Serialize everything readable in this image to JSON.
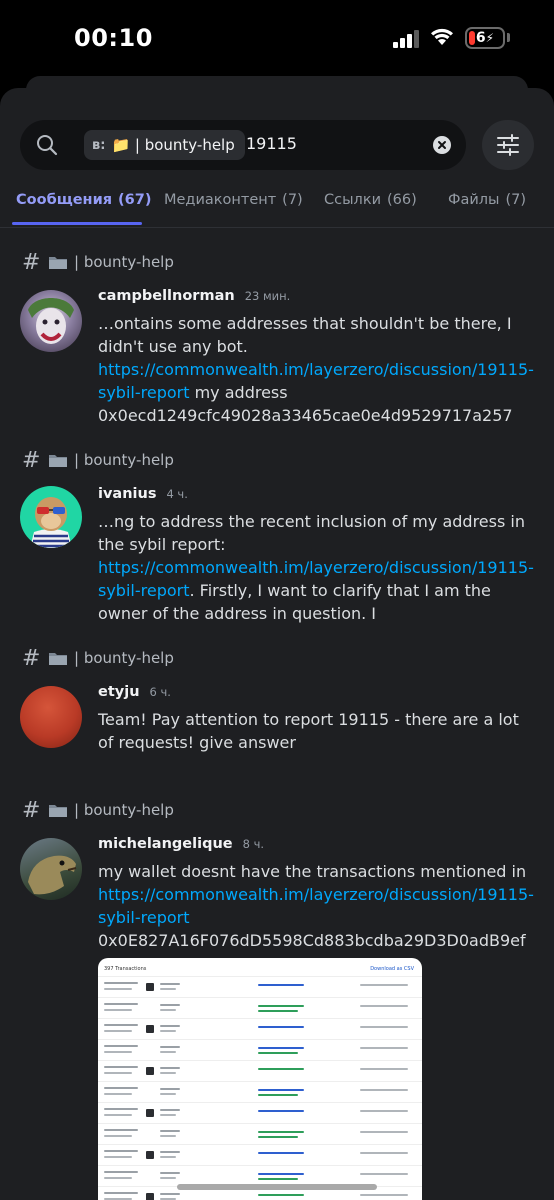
{
  "status_bar": {
    "time": "00:10",
    "battery": "6"
  },
  "search": {
    "scope_prefix": "в:",
    "scope_channel": "📁 | bounty-help",
    "query": "19115"
  },
  "tabs": [
    {
      "label": "Сообщения",
      "count": "(67)",
      "active": true
    },
    {
      "label": "Медиаконтент",
      "count": "(7)",
      "active": false
    },
    {
      "label": "Ссылки",
      "count": "(66)",
      "active": false
    },
    {
      "label": "Файлы",
      "count": "(7)",
      "active": false
    }
  ],
  "results": [
    {
      "channel": "| bounty-help",
      "author": "campbellnorman",
      "time": "23 мин.",
      "text_before": "…ontains some addresses that shouldn't be there, I didn't use any bot. ",
      "link": "https://commonwealth.im/layerzero/discussion/19115-sybil-report",
      "text_after": " my address 0x0ecd1249cfc49028a33465cae0e4d9529717a257"
    },
    {
      "channel": "| bounty-help",
      "author": "ivanius",
      "time": "4 ч.",
      "text_before": "…ng to address the recent inclusion of my address in the sybil report: ",
      "link": "https://commonwealth.im/layerzero/discussion/19115-sybil-report",
      "text_after": ". Firstly, I want to clarify that I am the owner of the address in question.  I"
    },
    {
      "channel": "| bounty-help",
      "author": "etyju",
      "time": "6 ч.",
      "text_before": "Team! Pay attention to report 19115 - there are a lot of requests! give answer",
      "link": "",
      "text_after": ""
    },
    {
      "channel": "| bounty-help",
      "author": "michelangelique",
      "time": "8 ч.",
      "text_before": "my wallet doesnt have the transactions mentioned in ",
      "link": "https://commonwealth.im/layerzero/discussion/19115-sybil-report",
      "text_after": " 0x0E827A16F076dD5598Cd883bcdba29D3D0adB9ef"
    }
  ],
  "attachment": {
    "header_left": "397 Transactions",
    "header_right": "Download as CSV"
  },
  "colors": {
    "background": "#1e1f22",
    "search_bg": "#111214",
    "accent": "#5865f2",
    "active_tab": "#949cf7",
    "link": "#00a8fc"
  }
}
